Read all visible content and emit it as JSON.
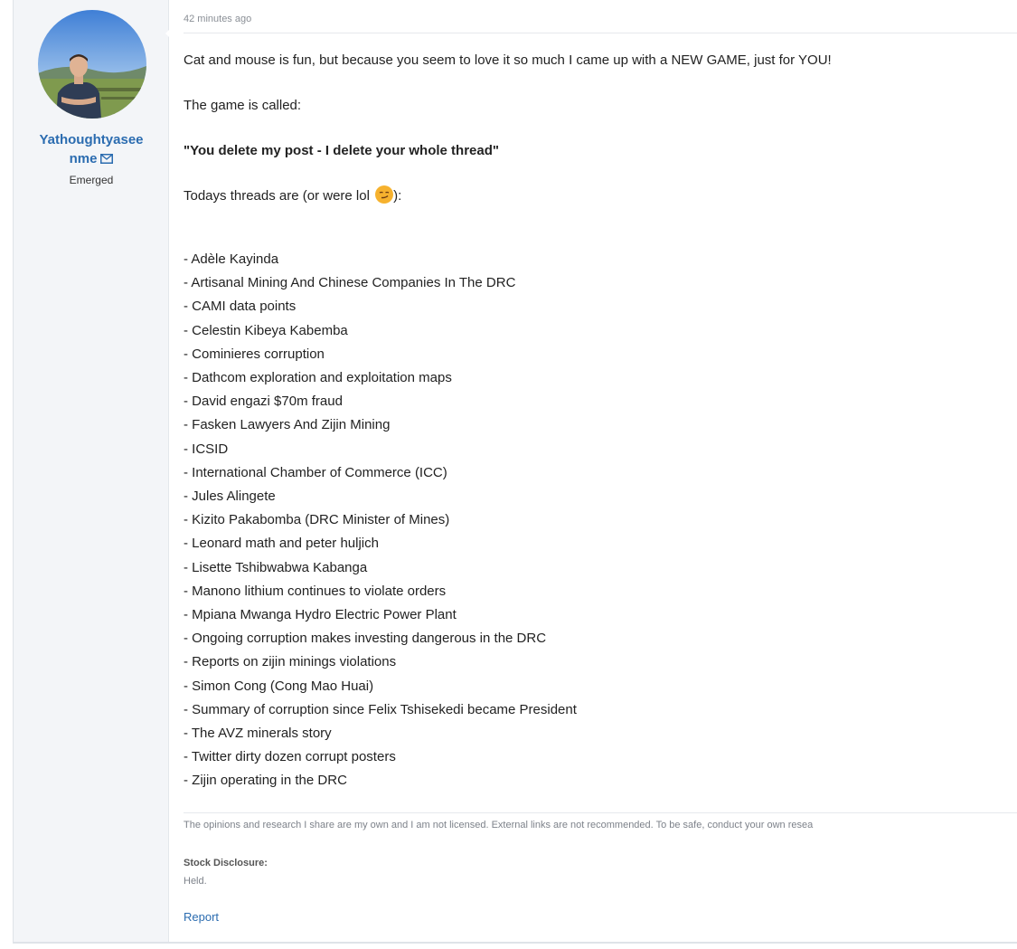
{
  "author": {
    "username_line1": "Yathoughtyasee",
    "username_line2": "nme",
    "rank": "Emerged"
  },
  "post": {
    "timestamp": "42 minutes ago",
    "intro": "Cat and mouse is fun, but because you seem to love it so much I came up with a NEW GAME, just for YOU!",
    "game_called": "The game is called:",
    "game_name": "\"You delete my post - I delete your whole thread\"",
    "todays_threads": "Todays threads are (or were lol",
    "todays_threads_end": "):",
    "threads": [
      "- Adèle Kayinda",
      "- Artisanal Mining And Chinese Companies In The DRC",
      "- CAMI data points",
      "- Celestin Kibeya Kabemba",
      "- Cominieres corruption",
      "- Dathcom exploration and exploitation maps",
      "- David engazi $70m fraud",
      "- Fasken Lawyers And Zijin Mining",
      "- ICSID",
      "- International Chamber of Commerce (ICC)",
      "- Jules Alingete",
      "- Kizito Pakabomba (DRC Minister of Mines)",
      "- Leonard math and peter huljich",
      "- Lisette Tshibwabwa Kabanga",
      "- Manono lithium continues to violate orders",
      "- Mpiana Mwanga Hydro Electric Power Plant",
      "- Ongoing corruption makes investing dangerous in the DRC",
      "- Reports on zijin minings violations",
      "- Simon Cong (Cong Mao Huai)",
      "- Summary of corruption since Felix Tshisekedi became President",
      "- The AVZ minerals story",
      "- Twitter dirty dozen corrupt posters",
      "- Zijin operating in the DRC"
    ]
  },
  "signature": {
    "text": "The opinions and research I share are my own and I am not licensed. External links are not recommended. To be safe, conduct your own resea"
  },
  "disclosure": {
    "label": "Stock Disclosure:",
    "value": "Held."
  },
  "actions": {
    "report": "Report"
  },
  "colors": {
    "username": "#2b6cb0",
    "link": "#2b6cb0",
    "sidebar_bg": "#f3f5f8"
  }
}
